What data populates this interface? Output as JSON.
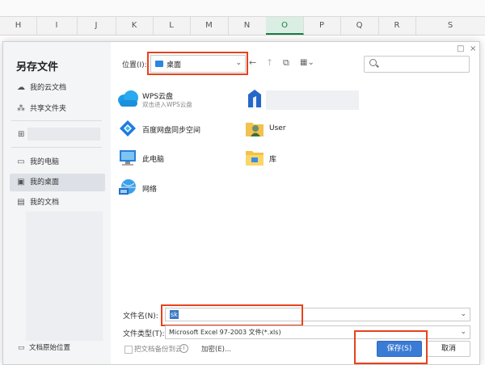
{
  "sheet": {
    "columns": [
      "H",
      "I",
      "J",
      "K",
      "L",
      "M",
      "N",
      "O",
      "P",
      "Q",
      "R",
      "S"
    ],
    "active_column": "O"
  },
  "dialog": {
    "title": "另存文件",
    "window_controls": [
      "□",
      "×"
    ],
    "sidebar": {
      "items": [
        {
          "label": "我的云文档",
          "icon": "cloud-icon"
        },
        {
          "label": "共享文件夹",
          "icon": "share-icon"
        },
        {
          "label": "我的电脑",
          "icon": "computer-icon"
        },
        {
          "label": "我的桌面",
          "icon": "desktop-icon",
          "active": true
        },
        {
          "label": "我的文档",
          "icon": "document-icon"
        },
        {
          "label": "文档原始位置",
          "icon": "folder-icon"
        }
      ]
    },
    "location": {
      "label": "位置(I):",
      "value": "桌面"
    },
    "items": [
      {
        "name": "WPS云盘",
        "subtitle": "双击进入WPS云盘",
        "icon": "wps-cloud-icon"
      },
      {
        "name": "百度网盘同步空间",
        "icon": "baidu-netdisk-icon"
      },
      {
        "name": "User",
        "icon": "user-folder-icon"
      },
      {
        "name": "此电脑",
        "icon": "this-pc-icon"
      },
      {
        "name": "库",
        "icon": "library-folder-icon"
      },
      {
        "name": "网络",
        "icon": "network-icon"
      }
    ],
    "filename": {
      "label": "文件名(N):",
      "value": "sk"
    },
    "filetype": {
      "label": "文件类型(T):",
      "value": "Microsoft Excel 97-2003 文件(*.xls)"
    },
    "backup_label": "把文档备份到云",
    "encrypt_label": "加密(E)...",
    "save_label": "保存(S)",
    "cancel_label": "取消",
    "colors": {
      "accent": "#3a7bd5",
      "highlight": "#e8421c"
    }
  }
}
